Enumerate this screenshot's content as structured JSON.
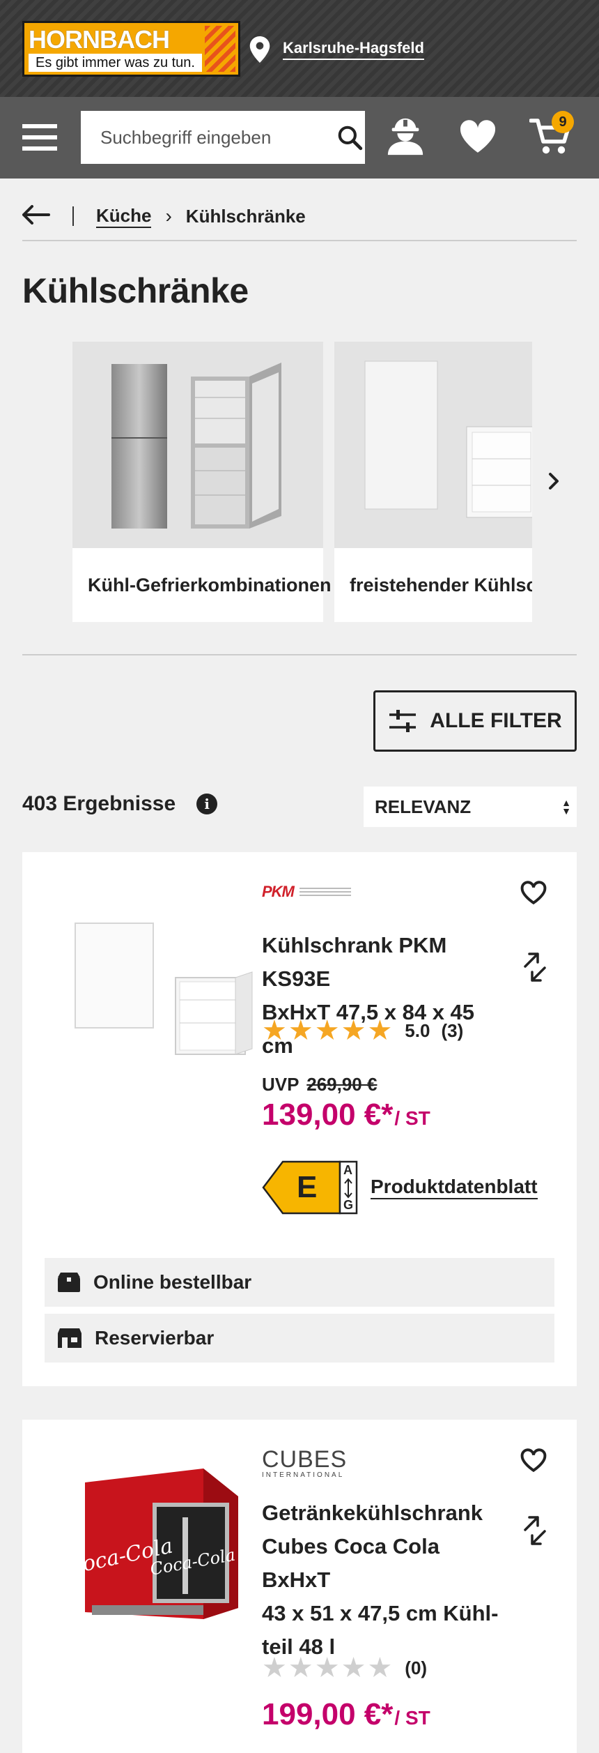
{
  "brand": {
    "logo_text": "HORNBACH",
    "slogan": "Es gibt immer was zu tun."
  },
  "header": {
    "location": "Karlsruhe-Hagsfeld",
    "search_placeholder": "Suchbegriff eingeben",
    "cart_count": "9"
  },
  "breadcrumb": {
    "parent": "Küche",
    "current": "Kühlschränke"
  },
  "page_title": "Kühlschränke",
  "categories": [
    {
      "label": "Kühl-Gefrierkombinationen"
    },
    {
      "label": "freistehender Kühlschrank"
    }
  ],
  "filter": {
    "label": "ALLE FILTER"
  },
  "results": {
    "count_text": "403 Ergebnisse",
    "info_icon": "i"
  },
  "sort": {
    "selected": "RELEVANZ"
  },
  "products": [
    {
      "brand": "PKM",
      "title_line1": "Kühlschrank PKM KS93E",
      "title_line2": "BxHxT 47,5 x 84 x 45 cm",
      "rating": "5.0",
      "reviews": "(3)",
      "stars_filled": 5,
      "uvp_label": "UVP",
      "uvp_price": "269,90 €",
      "price": "139,00 €*",
      "unit": "/ ST",
      "energy_class": "E",
      "energy_top": "A",
      "energy_bottom": "G",
      "datasheet": "Produktdatenblatt",
      "availability": [
        "Online bestellbar",
        "Reservierbar"
      ]
    },
    {
      "brand": "CUBES",
      "brand_sub": "INTERNATIONAL",
      "title_line1": "Getränkekühlschrank",
      "title_line2": "Cubes Coca Cola BxHxT",
      "title_line3": "43 x 51 x 47,5 cm Kühl-",
      "title_line4": "teil 48 l",
      "reviews": "(0)",
      "stars_filled": 0,
      "price": "199,00 €*",
      "unit": "/ ST",
      "image_text": "Coca-Cola"
    }
  ],
  "colors": {
    "price": "#c4006a",
    "star": "#f5a623",
    "accent": "#f5a700",
    "energy_e": "#f7b500"
  }
}
